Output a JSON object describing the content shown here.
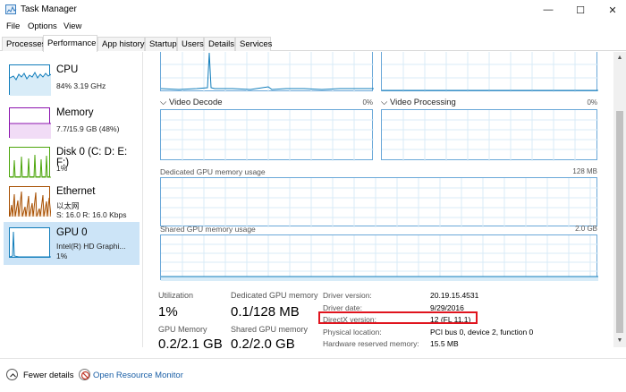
{
  "window": {
    "title": "Task Manager",
    "minimize_glyph": "—",
    "maximize_glyph": "☐",
    "close_glyph": "✕"
  },
  "menu": [
    "File",
    "Options",
    "View"
  ],
  "tabs": [
    "Processes",
    "Performance",
    "App history",
    "Startup",
    "Users",
    "Details",
    "Services"
  ],
  "active_tab": "Performance",
  "sidebar": {
    "items": [
      {
        "name": "CPU",
        "sub1": "84% 3.19 GHz",
        "sub2": "",
        "color": "#117dbb",
        "icon": "cpu-graph-icon"
      },
      {
        "name": "Memory",
        "sub1": "7.7/15.9 GB (48%)",
        "sub2": "",
        "color": "#8b12ae",
        "icon": "memory-graph-icon"
      },
      {
        "name": "Disk 0 (C: D: E: F:)",
        "sub1": "1%",
        "sub2": "",
        "color": "#4da60c",
        "icon": "disk-graph-icon"
      },
      {
        "name": "Ethernet",
        "sub1": "以太网",
        "sub2": "S: 16.0  R: 16.0 Kbps",
        "color": "#a74f01",
        "icon": "ethernet-graph-icon"
      },
      {
        "name": "GPU 0",
        "sub1": "Intel(R) HD Graphi...",
        "sub2": "1%",
        "color": "#117dbb",
        "icon": "gpu-graph-icon"
      }
    ],
    "selected": "GPU 0"
  },
  "graphs": {
    "video_decode": {
      "label": "Video Decode",
      "value": "0%"
    },
    "video_processing": {
      "label": "Video Processing",
      "value": "0%"
    },
    "dedicated": {
      "label": "Dedicated GPU memory usage",
      "value": "128 MB"
    },
    "shared": {
      "label": "Shared GPU memory usage",
      "value": "2.0 GB"
    }
  },
  "stats": {
    "utilization": {
      "label": "Utilization",
      "value": "1%"
    },
    "dedicated_memory": {
      "label": "Dedicated GPU memory",
      "value": "0.1/128 MB"
    },
    "gpu_memory": {
      "label": "GPU Memory",
      "value": "0.2/2.1 GB"
    },
    "shared_memory": {
      "label": "Shared GPU memory",
      "value": "0.2/2.0 GB"
    }
  },
  "info": [
    {
      "label": "Driver version:",
      "value": "20.19.15.4531"
    },
    {
      "label": "Driver date:",
      "value": "9/29/2016"
    },
    {
      "label": "DirectX version:",
      "value": "12 (FL 11.1)"
    },
    {
      "label": "Physical location:",
      "value": "PCI bus 0, device 2, function 0"
    },
    {
      "label": "Hardware reserved memory:",
      "value": "15.5 MB"
    }
  ],
  "highlight_color": "#e0141e",
  "footer": {
    "fewer_details": "Fewer details",
    "open_resource_monitor": "Open Resource Monitor"
  }
}
